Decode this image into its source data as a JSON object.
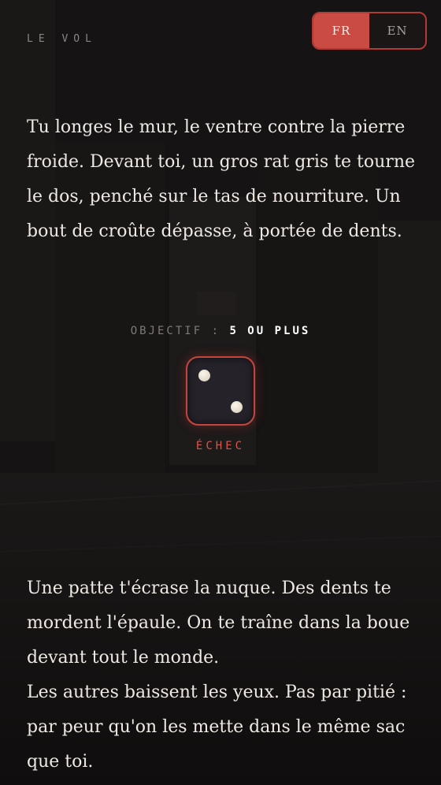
{
  "header": {
    "title": "LE VOL"
  },
  "language": {
    "options": [
      {
        "label": "FR",
        "active": true
      },
      {
        "label": "EN",
        "active": false
      }
    ]
  },
  "story": {
    "paragraph_1": "Tu longes le mur, le ventre contre la pierre froide. Devant toi, un gros rat gris te tourne le dos, penché sur le tas de nourriture. Un bout de croûte dépasse, à portée de dents.",
    "paragraph_2_line_1": "Une patte t'écrase la nuque. Des dents te mordent l'épaule. On te traîne dans la boue devant tout le monde.",
    "paragraph_2_line_2": "Les autres baissent les yeux. Pas par pitié : par peur qu'on les mette dans le même sac que toi."
  },
  "roll": {
    "objective_label": "OBJECTIF",
    "separator": ":",
    "objective_value": "5 OU PLUS",
    "die_value": 2,
    "result": "ÉCHEC"
  },
  "colors": {
    "accent": "#c94b43",
    "background": "#141212",
    "failure": "#d6574d"
  }
}
